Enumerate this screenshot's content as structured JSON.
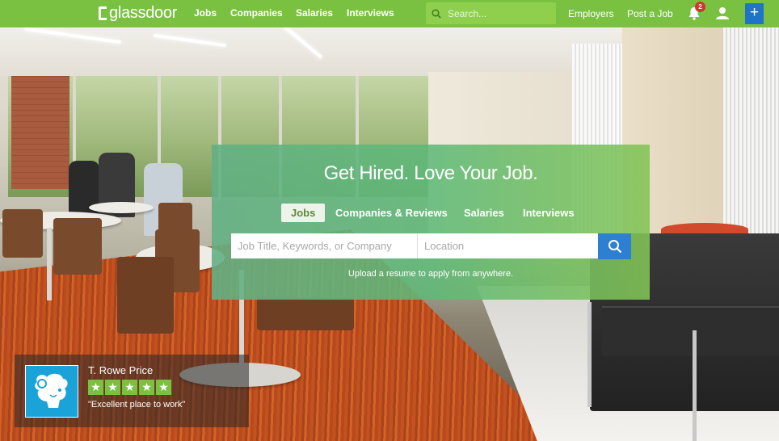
{
  "brand": {
    "name": "glassdoor"
  },
  "nav": {
    "links": [
      "Jobs",
      "Companies",
      "Salaries",
      "Interviews"
    ],
    "search_placeholder": "Search...",
    "employers": "Employers",
    "post_job": "Post a Job",
    "notification_count": "2",
    "plus_label": "+"
  },
  "hero": {
    "headline": "Get Hired. Love Your Job.",
    "tabs": [
      "Jobs",
      "Companies & Reviews",
      "Salaries",
      "Interviews"
    ],
    "active_tab": "Jobs",
    "job_placeholder": "Job Title, Keywords, or Company",
    "location_placeholder": "Location",
    "upload_text": "Upload a resume to apply from anywhere."
  },
  "employer": {
    "name": "T. Rowe Price",
    "rating_stars": 5,
    "quote": "\"Excellent place to work\""
  },
  "colors": {
    "nav_green": "#7ac142",
    "action_blue": "#2c7fd1",
    "badge_red": "#d9322a",
    "logo_blue": "#1aa3d9"
  },
  "icons": [
    "search-icon",
    "bell-icon",
    "user-icon",
    "plus-icon",
    "star-icon",
    "ram-logo-icon"
  ]
}
